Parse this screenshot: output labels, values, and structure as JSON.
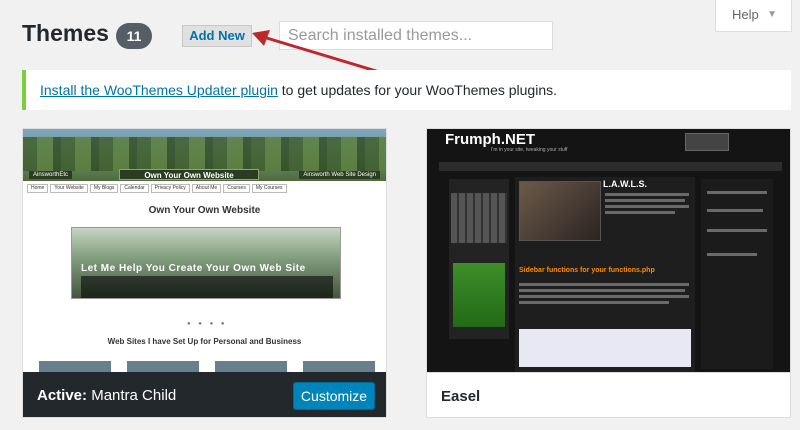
{
  "header": {
    "title": "Themes",
    "count": "11",
    "add_new_label": "Add New",
    "search_placeholder": "Search installed themes..."
  },
  "help": {
    "label": "Help"
  },
  "notice": {
    "link_text": "Install the WooThemes Updater plugin",
    "text": " to get updates for your WooThemes plugins.",
    "accent_color": "#7ad03a"
  },
  "themes": [
    {
      "active_prefix": "Active:",
      "name": "Mantra Child",
      "customize_label": "Customize",
      "preview": {
        "banner": "Own Your Own Website",
        "left_tag": "AinsworthEtc",
        "right_tag": "Ainsworth Web Site Design",
        "nav": [
          "Home",
          "Your Website",
          "My Blogs",
          "Calendar",
          "Privacy Policy",
          "About Me",
          "Courses",
          "My Courses"
        ],
        "heading": "Own Your Own Website",
        "slide_title": "Let Me Help You Create Your Own Web Site",
        "subheading": "Web Sites I have Set Up for Personal and Business"
      }
    },
    {
      "name": "Easel",
      "preview": {
        "logo": "Frumph.NET",
        "subtitle": "I'm in your site, tweaking your stuff",
        "post_title": "L.A.W.L.S.",
        "post2_title": "Sidebar functions for your functions.php"
      }
    }
  ],
  "colors": {
    "primary_button": "#0085ba",
    "link": "#0073aa",
    "active_footer": "#23282d",
    "arrow": "#c0272d"
  }
}
